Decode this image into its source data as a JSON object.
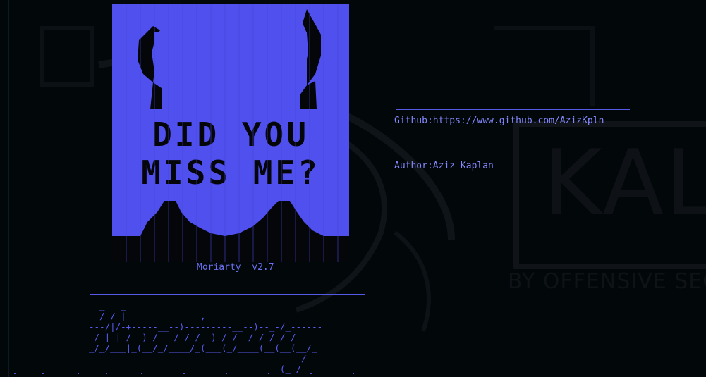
{
  "wallpaper": {
    "brand": "KAL",
    "tagline": "BY OFFENSIVE SEC"
  },
  "art": {
    "description_icon": "cat-ascii-art-icon",
    "headline_line1": "DID YOU",
    "headline_line2": "MISS ME?"
  },
  "version_label": "Moriarty  v2.7",
  "info": {
    "github": "Github:https://www.github.com/AzizKpln",
    "author": "Author:Aziz Kaplan"
  },
  "banner_lines": [
    "  _   _                                        ",
    "  / / |              ,                        ",
    "---/|/-+-----__--)---------__--)--_-/_------",
    " / | | /  ) /   / / /  ) / /  / / / / /    ",
    "_/_/___|_(__/_/____/_(___(_/____(__(__(__/_",
    "                                        /  ",
    "                                    (_ /   "
  ],
  "colors": {
    "background": "#020709",
    "accent": "#4f50ee",
    "text": "#8488ff"
  }
}
